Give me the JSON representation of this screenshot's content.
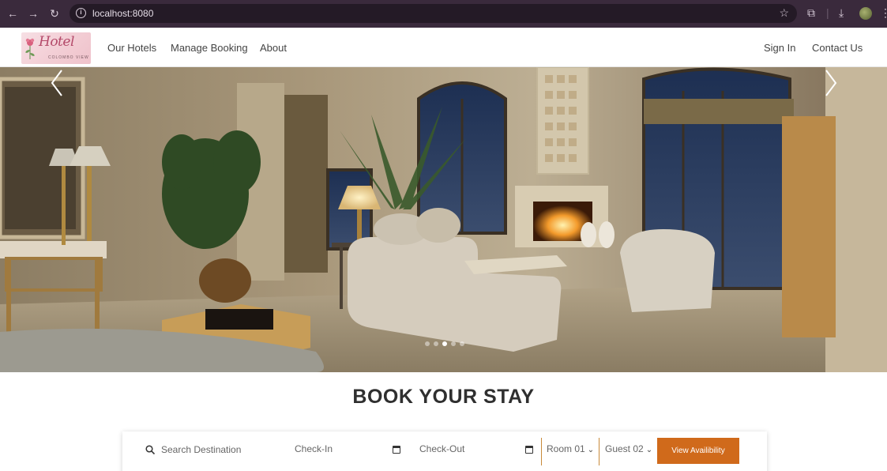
{
  "browser": {
    "url": "localhost:8080",
    "icons": [
      "back-arrow-icon",
      "forward-arrow-icon",
      "reload-icon",
      "site-info-icon",
      "bookmark-star-icon",
      "extensions-icon",
      "download-icon",
      "profile-avatar",
      "menu-icon"
    ]
  },
  "header": {
    "logo_script": "Hotel",
    "logo_sub": "COLOMBO VIEW",
    "nav": [
      "Our Hotels",
      "Manage Booking",
      "About"
    ],
    "nav_right": [
      "Sign In",
      "Contact Us"
    ]
  },
  "hero": {
    "slide_count": 5,
    "active_slide": 3
  },
  "booking": {
    "title": "BOOK YOUR STAY",
    "search_placeholder": "Search Destination",
    "checkin_placeholder": "Check-In",
    "checkout_placeholder": "Check-Out",
    "room": "Room 01",
    "guest": "Guest 02",
    "button": "View Availibility"
  },
  "colors": {
    "browser_frame": "#3a2a3c",
    "accent": "#d06a1b",
    "separator": "#c88a3a"
  }
}
